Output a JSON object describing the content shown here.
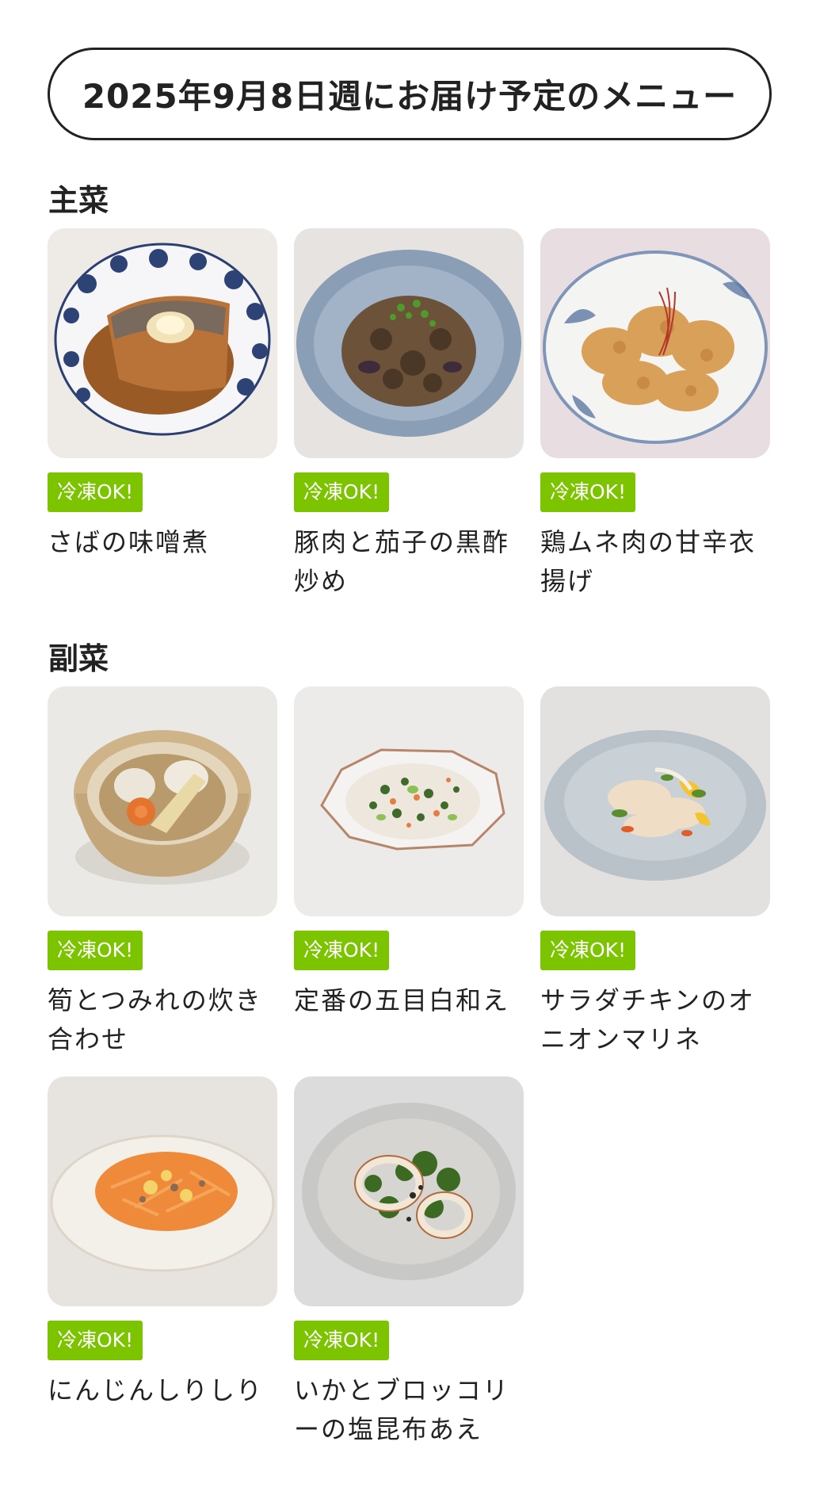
{
  "title": "2025年9月8日週にお届け予定のメニュー",
  "colors": {
    "badge_bg": "#7cc300",
    "text": "#222222",
    "border": "#222222"
  },
  "sections": {
    "main": {
      "label": "主菜",
      "items": [
        {
          "badge": "冷凍OK!",
          "name": "さばの味噌煮"
        },
        {
          "badge": "冷凍OK!",
          "name": "豚肉と茄子の黒酢炒め"
        },
        {
          "badge": "冷凍OK!",
          "name": "鶏ムネ肉の甘辛衣揚げ"
        }
      ]
    },
    "side": {
      "label": "副菜",
      "items": [
        {
          "badge": "冷凍OK!",
          "name": "筍とつみれの炊き合わせ"
        },
        {
          "badge": "冷凍OK!",
          "name": "定番の五目白和え"
        },
        {
          "badge": "冷凍OK!",
          "name": "サラダチキンのオニオンマリネ"
        },
        {
          "badge": "冷凍OK!",
          "name": "にんじんしりしり"
        },
        {
          "badge": "冷凍OK!",
          "name": "いかとブロッコリーの塩昆布あえ"
        }
      ]
    }
  }
}
